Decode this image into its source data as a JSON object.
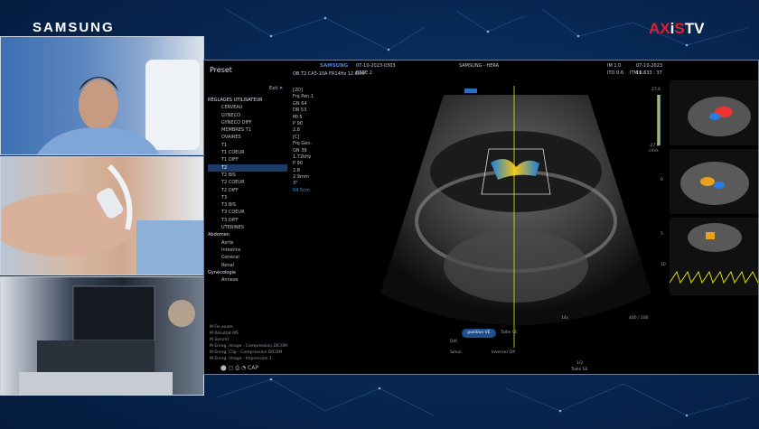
{
  "branding": {
    "samsung_logo": "SAMSUNG",
    "channel_logo_part1": "AX",
    "channel_logo_part2": "i",
    "channel_logo_part3": "S",
    "channel_logo_part4": "TV"
  },
  "colors": {
    "background": "#0a2f63",
    "accent_blue": "#1e4f8e",
    "selection": "#1b3c6a",
    "channel_red": "#e0202a"
  },
  "screen": {
    "preset_title": "Preset",
    "exit_label": "Exit ✕",
    "header": {
      "date_left": "07-10-2023-0303",
      "bebe": "BEBE 2",
      "samsung": "SAMSUNG",
      "device": "SAMSUNG - HERA",
      "im": "IM 1.0",
      "date_right": "07-10-2023",
      "ito": "ITO 0.6",
      "itm": "ITM 0.6",
      "time": "11 : 33 : 37"
    },
    "probe_line": "OB  T2  CA5-10A  FR14Hz  12.6cm",
    "tree": [
      {
        "label": "RÉGLAGES UTILISATEUR",
        "type": "cat"
      },
      {
        "label": "CERVEAU",
        "type": "sub"
      },
      {
        "label": "GYNECO",
        "type": "sub"
      },
      {
        "label": "GYNECO DIFF",
        "type": "sub"
      },
      {
        "label": "MEMBRES T1",
        "type": "sub"
      },
      {
        "label": "OVAIRES",
        "type": "sub"
      },
      {
        "label": "T1",
        "type": "sub"
      },
      {
        "label": "T1 COEUR",
        "type": "sub"
      },
      {
        "label": "T1 DIFF",
        "type": "sub"
      },
      {
        "label": "T2",
        "type": "sel"
      },
      {
        "label": "T2 BIS",
        "type": "sub"
      },
      {
        "label": "T2 COEUR",
        "type": "sub"
      },
      {
        "label": "T2 DIFF",
        "type": "sub"
      },
      {
        "label": "T3",
        "type": "sub"
      },
      {
        "label": "T3 BIS",
        "type": "sub"
      },
      {
        "label": "T3 COEUR",
        "type": "sub"
      },
      {
        "label": "T3 DIFF",
        "type": "sub"
      },
      {
        "label": "UTERINES",
        "type": "sub"
      },
      {
        "label": "Abdomen",
        "type": "cat"
      },
      {
        "label": "Aorte",
        "type": "sub"
      },
      {
        "label": "Intestins",
        "type": "sub"
      },
      {
        "label": "Général",
        "type": "sub"
      },
      {
        "label": "Rénal",
        "type": "sub"
      },
      {
        "label": "Gynécologie",
        "type": "cat"
      },
      {
        "label": "Annexe",
        "type": "sub"
      }
    ],
    "params": [
      {
        "label": "[2D]",
        "hl": false
      },
      {
        "label": "Frq  Pen.1",
        "hl": false
      },
      {
        "label": "GN  64",
        "hl": false
      },
      {
        "label": "DR  53",
        "hl": false
      },
      {
        "label": "MI  5",
        "hl": false
      },
      {
        "label": "P  90",
        "hl": false
      },
      {
        "label": "2.8",
        "hl": false
      },
      {
        "label": "[C]",
        "hl": false
      },
      {
        "label": "Frq  Gén.",
        "hl": false
      },
      {
        "label": "GN  39",
        "hl": false
      },
      {
        "label": "1.72kHz",
        "hl": false
      },
      {
        "label": "P  90",
        "hl": false
      },
      {
        "label": "2.8",
        "hl": false
      },
      {
        "label": "2.9mm",
        "hl": false
      },
      {
        "label": "3°",
        "hl": false
      },
      {
        "label": "04.5cm",
        "hl": true
      }
    ],
    "bottom_list": [
      "M  Fin exam",
      "M  Résultat MS",
      "M  SonoVr",
      "M  Enreg. Image - Compression DICOM",
      "M  Enreg. Clip - Compression DICOM",
      "M  Enreg. Image - Impression 1"
    ],
    "bottom_icons": "⬤  ▢  ⎙  ◔  CAP",
    "scale_left": "14s",
    "scale_right": "400 / 100",
    "controls": {
      "position": "position VE",
      "taille": "Taille VE",
      "left": "Déf.",
      "left2": "Simul.",
      "right": "Inverser DP",
      "page": "1/2",
      "page2": "Taille SE"
    },
    "color_scale_top": "27.6",
    "color_scale_bottom": "-27.6",
    "color_scale_unit": "cm/s",
    "depth_marks": [
      "0",
      "5",
      "10"
    ]
  }
}
